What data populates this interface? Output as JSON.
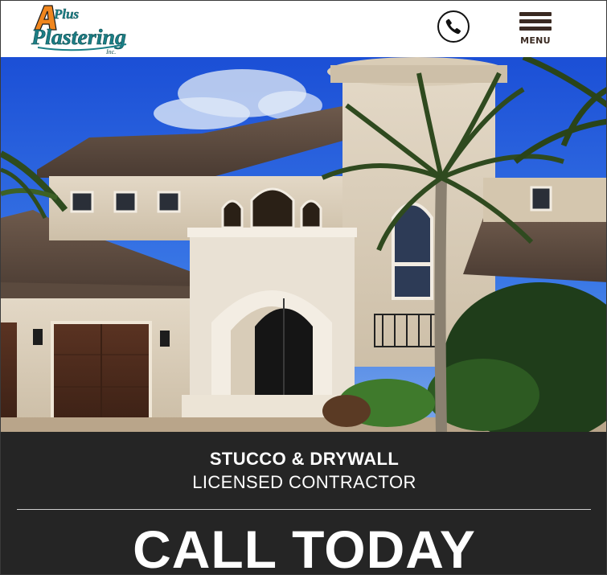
{
  "header": {
    "logo": {
      "line1": "A Plus",
      "line2": "Plastering",
      "line3": "Inc."
    },
    "phone_icon": "phone-icon",
    "menu_icon": "hamburger-icon",
    "menu_label": "MENU"
  },
  "hero": {
    "image_alt": "Two-story stucco home with tile roof, arched entry and palm trees"
  },
  "band": {
    "line1": "STUCCO & DRYWALL",
    "line2": "LICENSED CONTRACTOR",
    "cta": "CALL TODAY"
  },
  "colors": {
    "logo_orange": "#f0861e",
    "logo_teal": "#1b7f86",
    "menu_brown": "#3a2a22",
    "band_bg": "#252525"
  }
}
